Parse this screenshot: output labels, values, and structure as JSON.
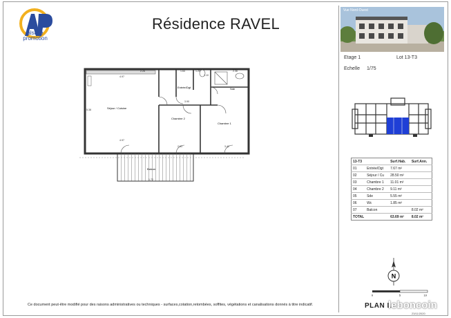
{
  "header": {
    "title": "Résidence RAVEL"
  },
  "logo": {
    "line1": "alsace",
    "line2": "promotion",
    "brand_color": "#2b4c9e",
    "accent_color": "#f2b01e"
  },
  "photo": {
    "caption": "Vue Nord-Ouest"
  },
  "meta": {
    "etage_label": "Etage 1",
    "lot_label": "Lot 13-T3",
    "echelle_label": "Echelle",
    "echelle_value": "1/75"
  },
  "rooms_table": {
    "headers": [
      "13-T3",
      "Surf.Hab.",
      "Surf.Ann."
    ],
    "rows": [
      {
        "num": "01",
        "name": "Entrée/Dgt",
        "hab": "7.67 m²",
        "ann": ""
      },
      {
        "num": "02",
        "name": "Séjour / Cu",
        "hab": "28.50 m²",
        "ann": ""
      },
      {
        "num": "03",
        "name": "Chambre 1",
        "hab": "11.01 m²",
        "ann": ""
      },
      {
        "num": "04",
        "name": "Chambre 2",
        "hab": "9.11 m²",
        "ann": ""
      },
      {
        "num": "05",
        "name": "Sde",
        "hab": "5.55 m²",
        "ann": ""
      },
      {
        "num": "06",
        "name": "Wc",
        "hab": "1.85 m²",
        "ann": ""
      },
      {
        "num": "07",
        "name": "Balcon",
        "hab": "",
        "ann": "8.02 m²"
      }
    ],
    "total": {
      "label": "TOTAL",
      "hab": "63.69 m²",
      "ann": "8.02 m²"
    }
  },
  "plan": {
    "room_labels": {
      "sejour": "Séjour / Cuisine",
      "entree": "Entrée/Dgt",
      "sde": "Sde",
      "ch1": "Chambre 1",
      "ch2": "Chambre 2",
      "balcon": "Balcon"
    },
    "dimensions": {
      "d1": "4.97",
      "d2": "2.26",
      "d3": "1.64",
      "d4": "2.36",
      "d5": "3.90",
      "d6": "5.38",
      "d7": "4.97",
      "d8": "2.63",
      "d9": "3.42",
      "d10": "1.25",
      "d11": "1.72",
      "d12": "1.10"
    }
  },
  "compass": {
    "letter": "N"
  },
  "scale": {
    "ticks": [
      "0",
      "5",
      "10"
    ]
  },
  "footer": {
    "plan_label": "PLAN L",
    "watermark": "leboncoin",
    "date": "23/11/2020",
    "disclaimer": "Ce document peut-être modifié pour des raisons administratives ou techniques - surfaces,cotation,retombées, soffites, végétations et canalisations donnés à titre indicatif."
  },
  "colors": {
    "wall": "#333333",
    "balcony_hatch": "#777777",
    "highlight": "#1f3fd6"
  }
}
